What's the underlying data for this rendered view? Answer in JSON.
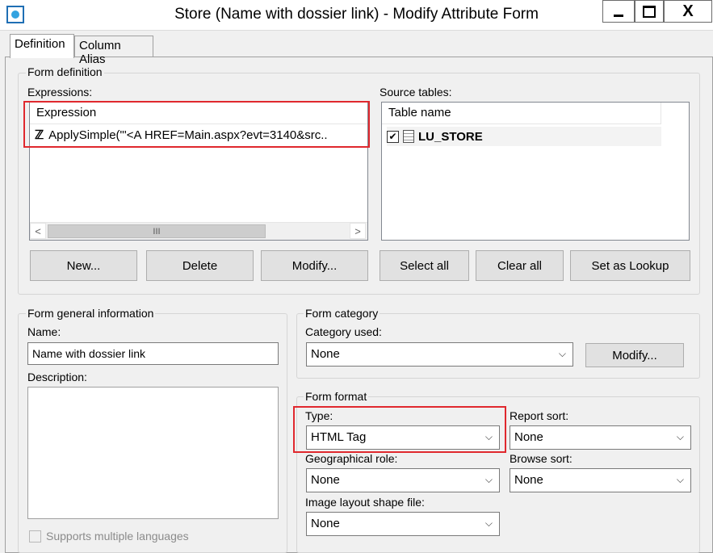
{
  "window": {
    "title": "Store (Name with dossier link) - Modify Attribute Form",
    "close_glyph": "X"
  },
  "tabs": [
    {
      "label": "Definition"
    },
    {
      "label": "Column Alias"
    }
  ],
  "form_definition": {
    "title": "Form definition",
    "expressions_label": "Expressions:",
    "expressions_header": "Expression",
    "expression_row": "ApplySimple(\"'<A HREF=Main.aspx?evt=3140&src..",
    "expression_icon_glyph": "ℤ",
    "scroll_left": "<",
    "scroll_right": ">",
    "scroll_thumb": "III",
    "source_tables_label": "Source tables:",
    "source_tables_header": "Table name",
    "table_row": "LU_STORE",
    "buttons": {
      "new": "New...",
      "delete": "Delete",
      "modify": "Modify...",
      "select_all": "Select all",
      "clear_all": "Clear all",
      "set_as_lookup": "Set as Lookup"
    }
  },
  "general_info": {
    "title": "Form general information",
    "name_label": "Name:",
    "name_value": "Name with dossier link",
    "description_label": "Description:",
    "description_value": "",
    "multi_lang_label": "Supports multiple languages"
  },
  "category": {
    "title": "Form category",
    "category_label": "Category used:",
    "category_value": "None",
    "modify_button": "Modify..."
  },
  "format": {
    "title": "Form format",
    "type_label": "Type:",
    "type_value": "HTML Tag",
    "report_sort_label": "Report sort:",
    "report_sort_value": "None",
    "geo_role_label": "Geographical role:",
    "geo_role_value": "None",
    "browse_sort_label": "Browse sort:",
    "browse_sort_value": "None",
    "shape_file_label": "Image layout shape file:",
    "shape_file_value": "None"
  },
  "icons": {
    "app": "app-icon",
    "chevron": "chevron-down-icon",
    "table": "table-icon",
    "check": "✔"
  },
  "colors": {
    "highlight": "#e0282e",
    "window_bg": "#f0f0f0"
  }
}
